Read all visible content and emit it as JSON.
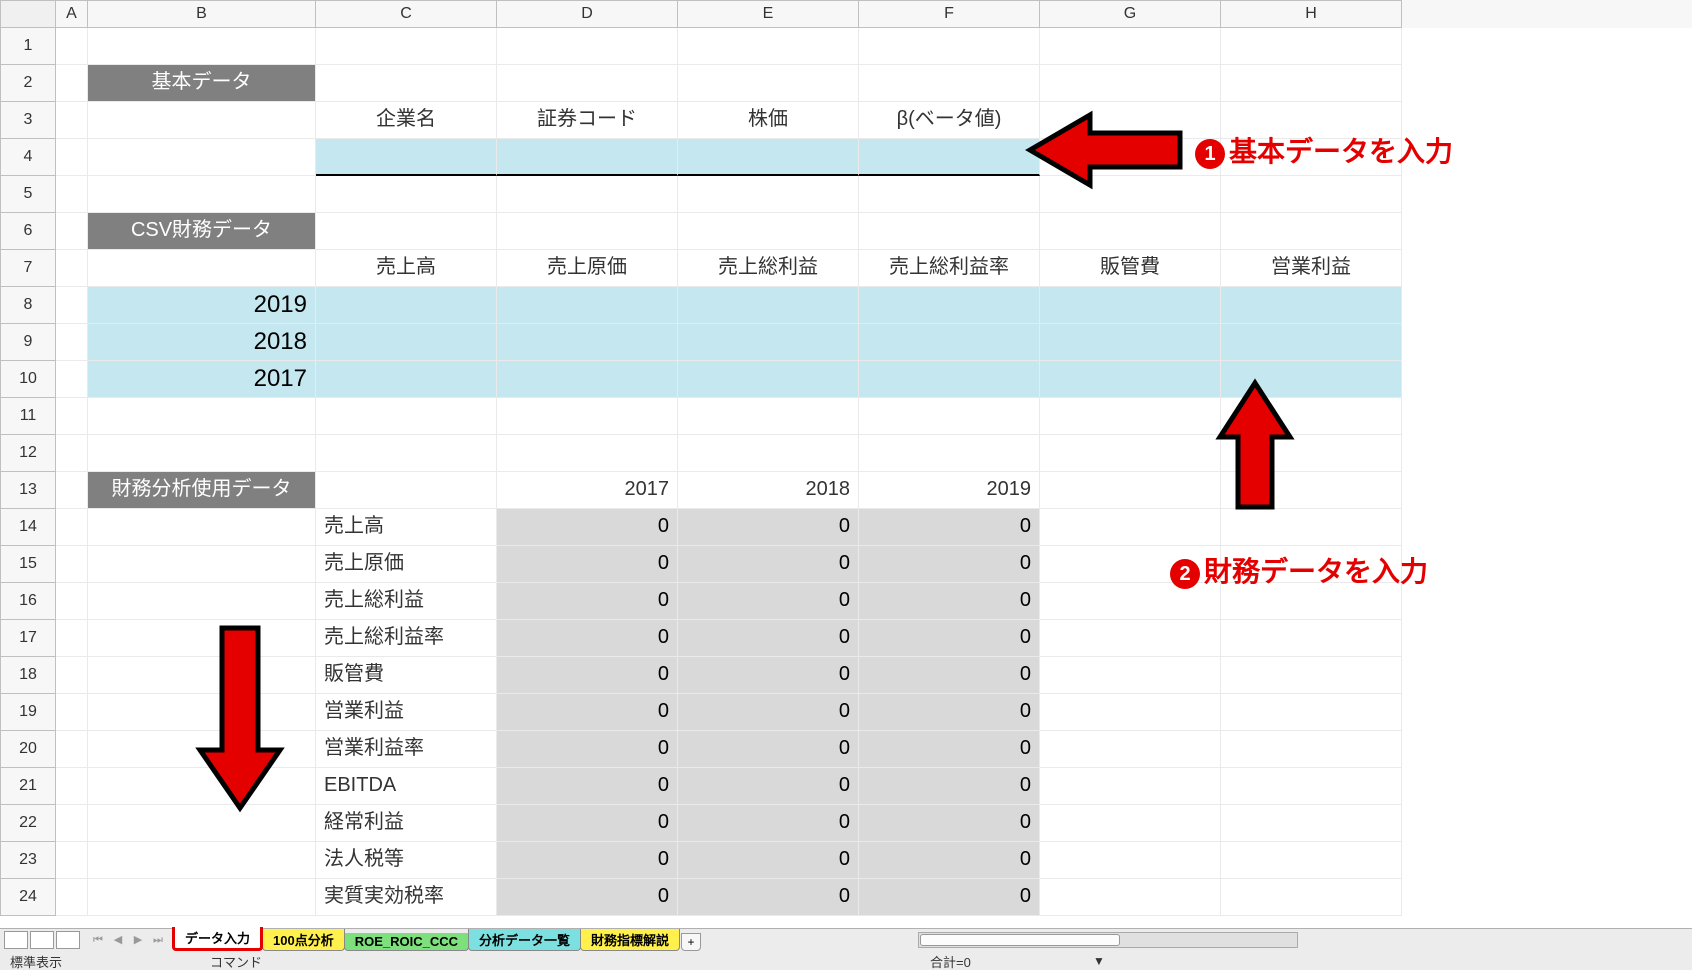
{
  "columns": [
    "A",
    "B",
    "C",
    "D",
    "E",
    "F",
    "G",
    "H"
  ],
  "rows": [
    1,
    2,
    3,
    4,
    5,
    6,
    7,
    8,
    9,
    10,
    11,
    12,
    13,
    14,
    15,
    16,
    17,
    18,
    19,
    20,
    21,
    22,
    23,
    24
  ],
  "sections": {
    "basic_data_header": "基本データ",
    "csv_header": "CSV財務データ",
    "analysis_header": "財務分析使用データ"
  },
  "basic_labels": {
    "company": "企業名",
    "code": "証券コード",
    "price": "株価",
    "beta": "β(ベータ値)"
  },
  "csv_col_labels": {
    "sales": "売上高",
    "cogs": "売上原価",
    "gross": "売上総利益",
    "gross_rate": "売上総利益率",
    "sga": "販管費",
    "op_income": "営業利益"
  },
  "csv_years": [
    "2019",
    "2018",
    "2017"
  ],
  "analysis_years": [
    "2017",
    "2018",
    "2019"
  ],
  "analysis_rows": [
    {
      "label": "売上高",
      "v": [
        "0",
        "0",
        "0"
      ]
    },
    {
      "label": "売上原価",
      "v": [
        "0",
        "0",
        "0"
      ]
    },
    {
      "label": "売上総利益",
      "v": [
        "0",
        "0",
        "0"
      ]
    },
    {
      "label": "売上総利益率",
      "v": [
        "0",
        "0",
        "0"
      ]
    },
    {
      "label": "販管費",
      "v": [
        "0",
        "0",
        "0"
      ]
    },
    {
      "label": "営業利益",
      "v": [
        "0",
        "0",
        "0"
      ]
    },
    {
      "label": "営業利益率",
      "v": [
        "0",
        "0",
        "0"
      ]
    },
    {
      "label": "EBITDA",
      "v": [
        "0",
        "0",
        "0"
      ]
    },
    {
      "label": "経常利益",
      "v": [
        "0",
        "0",
        "0"
      ]
    },
    {
      "label": "法人税等",
      "v": [
        "0",
        "0",
        "0"
      ]
    },
    {
      "label": "実質実効税率",
      "v": [
        "0",
        "0",
        "0"
      ]
    }
  ],
  "annotations": {
    "a1_num": "1",
    "a1_text": "基本データを入力",
    "a2_num": "2",
    "a2_text": "財務データを入力"
  },
  "sheet_tabs": {
    "t0": "データ入力",
    "t1": "100点分析",
    "t2": "ROE_ROIC_CCC",
    "t3": "分析データ一覧",
    "t4": "財務指標解説"
  },
  "status": {
    "view": "標準表示",
    "cmd": "コマンド",
    "sum": "合計=0"
  }
}
